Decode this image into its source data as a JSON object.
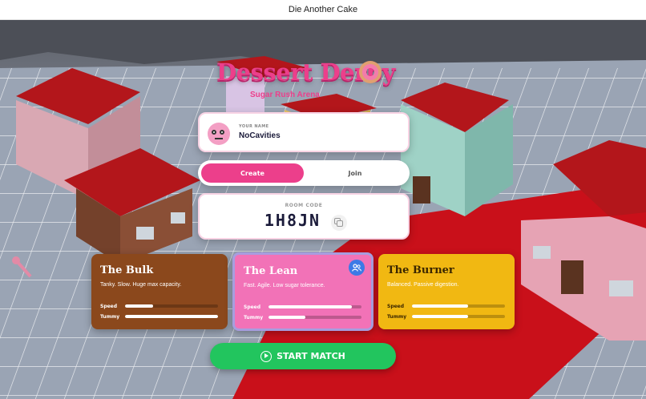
{
  "window": {
    "title": "Die Another Cake"
  },
  "logo": {
    "title": "Dessert Derby",
    "subtitle": "Sugar Rush Arena"
  },
  "player": {
    "name_label": "YOUR NAME",
    "name": "NoCavities"
  },
  "tabs": [
    {
      "label": "Create",
      "active": true
    },
    {
      "label": "Join",
      "active": false
    }
  ],
  "room": {
    "label": "ROOM CODE",
    "code": "1H8JN"
  },
  "characters": [
    {
      "name": "The Bulk",
      "description": "Tanky. Slow. Huge max capacity.",
      "speed_label": "Speed",
      "tummy_label": "Tummy",
      "speed": 0.3,
      "tummy": 1.0,
      "color": "#8b481c"
    },
    {
      "name": "The Lean",
      "description": "Fast. Agile. Low sugar tolerance.",
      "speed_label": "Speed",
      "tummy_label": "Tummy",
      "speed": 0.9,
      "tummy": 0.4,
      "color": "#f272b7",
      "selected": true
    },
    {
      "name": "The Burner",
      "description": "Balanced. Passive digestion.",
      "speed_label": "Speed",
      "tummy_label": "Tummy",
      "speed": 0.6,
      "tummy": 0.6,
      "color": "#f1b812"
    }
  ],
  "actions": {
    "start_label": "START MATCH"
  },
  "colors": {
    "accent": "#ec3f8b",
    "start": "#22c55e",
    "roof": "#b3161b"
  }
}
